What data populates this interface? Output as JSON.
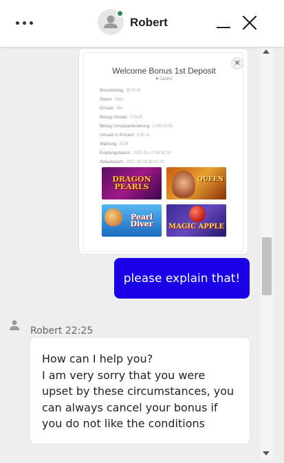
{
  "header": {
    "agent_name": "Robert",
    "online_status_color": "#2e8b57",
    "icons": [
      "more-options-icon",
      "user-avatar-icon",
      "minimize-icon",
      "close-icon"
    ]
  },
  "image_message": {
    "title": "Welcome Bonus 1st Deposit",
    "subtitle": "Casino",
    "details": [
      {
        "label": "Bonusbetrag:",
        "value": "50 EUR"
      },
      {
        "label": "Status:",
        "value": "Aktiv"
      },
      {
        "label": "Einsatz:",
        "value": "45x"
      },
      {
        "label": "Betrag Umsatz:",
        "value": "0 EUR"
      },
      {
        "label": "Betrag Umsatzanforderung:",
        "value": "2,250 EUR"
      },
      {
        "label": "Umsatz in Prozent:",
        "value": "0.00 %"
      },
      {
        "label": "Währung:",
        "value": "EUR"
      },
      {
        "label": "Empfangsdatum:",
        "value": "2022-03-12 09:42:30"
      },
      {
        "label": "Ablaufdatum:",
        "value": "2022-03-19 09:42:30"
      }
    ],
    "games": [
      {
        "name": "DRAGON PEARLS"
      },
      {
        "name": "QUEEN"
      },
      {
        "name": "Pearl Diver"
      },
      {
        "name": "MAGIC APPLE"
      }
    ]
  },
  "outgoing_message": {
    "text": "please explain that!",
    "bubble_color": "#1a00e6"
  },
  "agent_message": {
    "sender": "Robert",
    "time": "22:25",
    "lines": [
      "How can I help you?",
      "I am very sorry that you were",
      "upset by these circumstances, you",
      "can always cancel your bonus if",
      "you do not like the conditions"
    ]
  }
}
